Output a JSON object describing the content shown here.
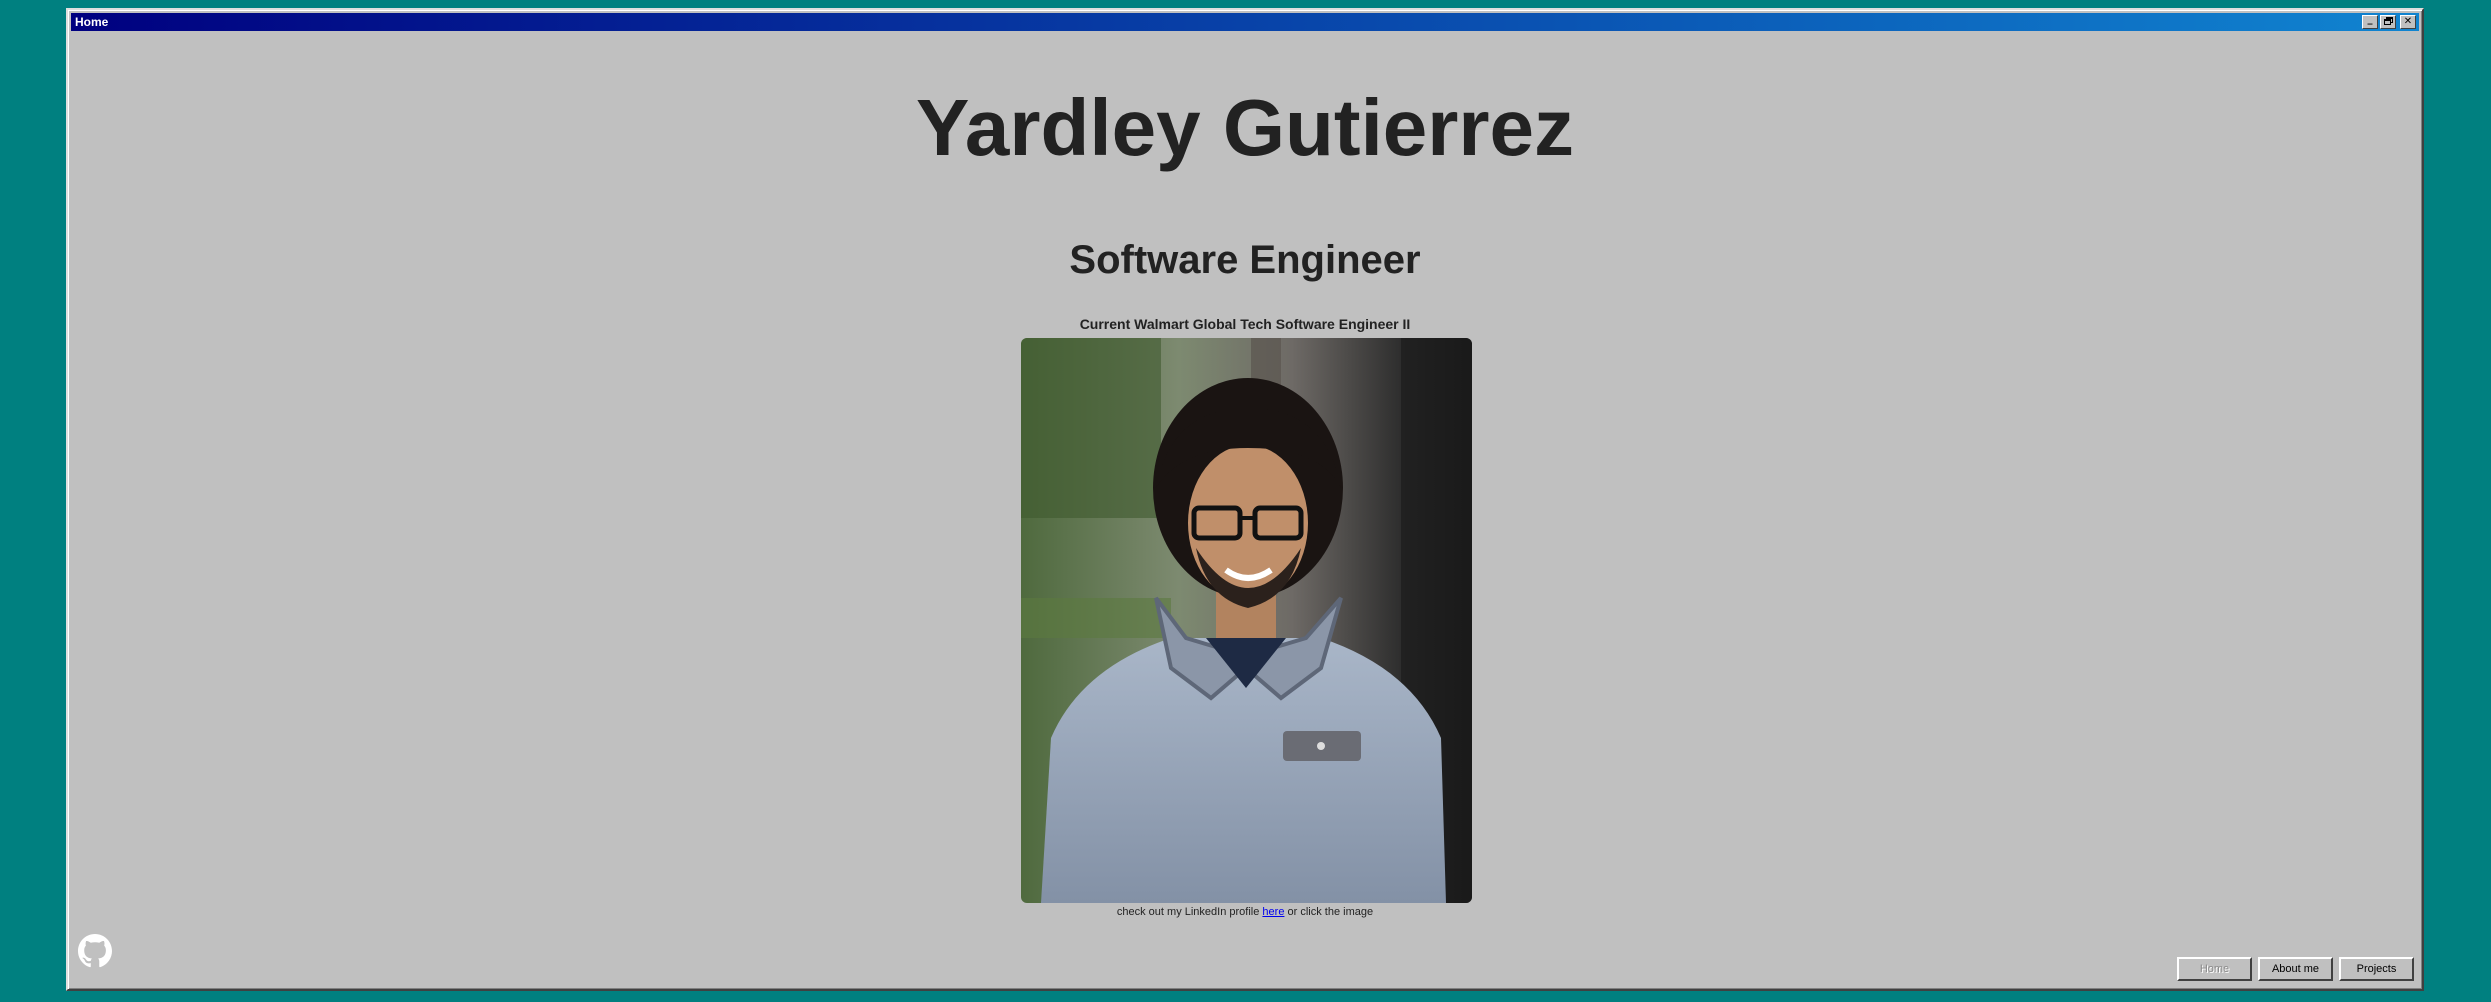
{
  "window": {
    "title": "Home",
    "controls": {
      "minimize": "_",
      "maximize": "▫",
      "close": "✕"
    }
  },
  "header": {
    "name": "Yardley Gutierrez",
    "role": "Software Engineer",
    "current_position": "Current Walmart Global Tech Software Engineer II"
  },
  "caption": {
    "before": "check out my LinkedIn profile ",
    "link": "here",
    "after": " or click the image"
  },
  "nav": {
    "home": "Home",
    "about": "About me",
    "projects": "Projects"
  },
  "icons": {
    "github": "github-icon"
  },
  "colors": {
    "desktop": "#008080",
    "window": "#c0c0c0",
    "titlebar_start": "#000080",
    "titlebar_end": "#1084d0",
    "text": "#222222",
    "link": "#0000ee"
  }
}
